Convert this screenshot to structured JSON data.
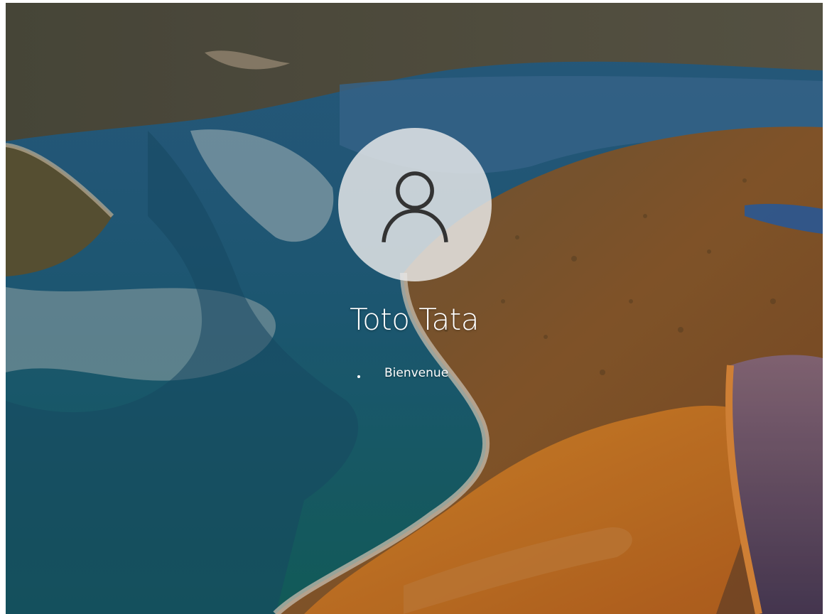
{
  "login": {
    "user_name": "Toto Tata",
    "status_text": "Bienvenue",
    "avatar_icon": "user-silhouette-icon",
    "spinner_icon": "loading-dot-icon"
  },
  "colors": {
    "text": "#ffffff",
    "avatar_bg": "#ebebeb",
    "avatar_glyph": "#333333"
  }
}
